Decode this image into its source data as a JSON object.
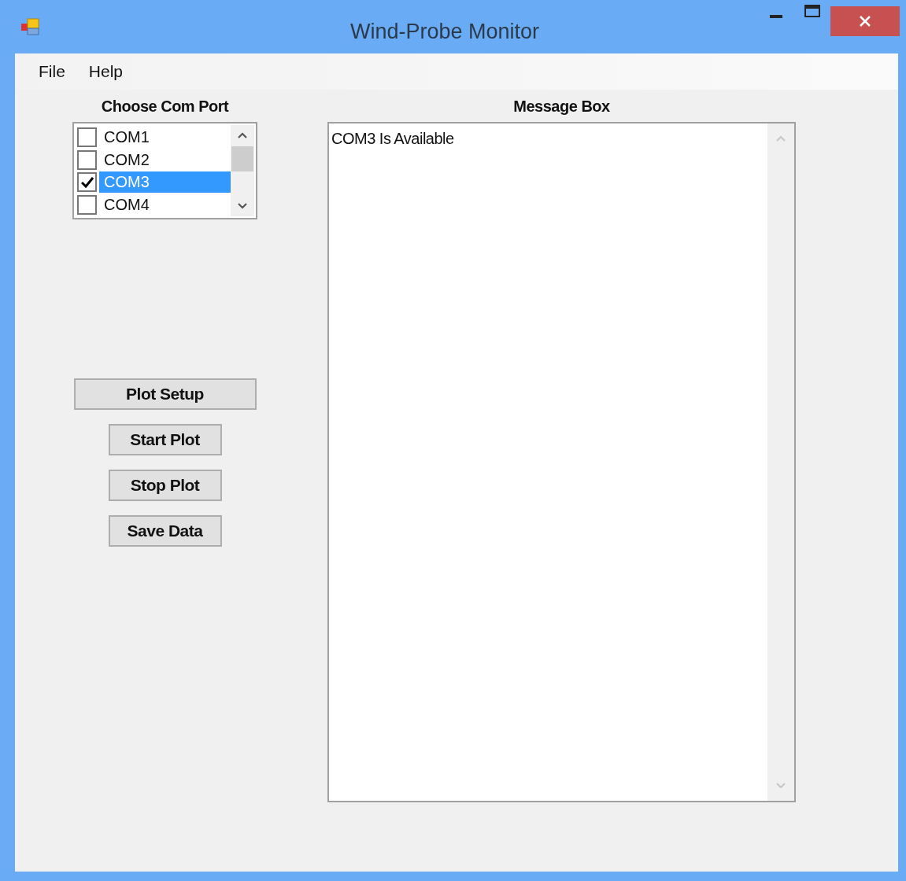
{
  "window": {
    "title": "Wind-Probe Monitor"
  },
  "menu": [
    "File",
    "Help"
  ],
  "com_port": {
    "label": "Choose Com Port",
    "items": [
      {
        "label": "COM1",
        "checked": false,
        "selected": false
      },
      {
        "label": "COM2",
        "checked": false,
        "selected": false
      },
      {
        "label": "COM3",
        "checked": true,
        "selected": true
      },
      {
        "label": "COM4",
        "checked": false,
        "selected": false
      }
    ]
  },
  "buttons": [
    {
      "label": "Plot Setup",
      "kind": "wide"
    },
    {
      "label": "Start Plot",
      "kind": "narrow"
    },
    {
      "label": "Stop Plot",
      "kind": "narrow"
    },
    {
      "label": "Save Data",
      "kind": "narrow"
    }
  ],
  "message_box": {
    "label": "Message Box",
    "value": "COM3 Is Available"
  }
}
